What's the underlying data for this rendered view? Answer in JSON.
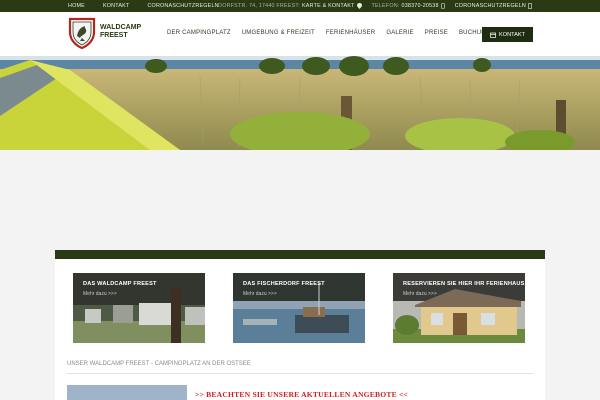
{
  "topbar": {
    "links": [
      "HOME",
      "KONTAKT",
      "CORONASCHUTZREGELN"
    ],
    "address": "DORFSTR. 74, 17440 FREEST:",
    "map_link": "KARTE & KONTAKT",
    "phone_label": "TELEFON:",
    "phone": "038370-20538",
    "corona_link": "CORONASCHUTZREGELN"
  },
  "brand": {
    "line1": "WALDCAMP",
    "line2": "FREEST"
  },
  "nav": {
    "items": [
      "DER CAMPINGPLATZ",
      "UMGEBUNG & FREIZEIT",
      "FERIENHÄUSER",
      "GALERIE",
      "PREISE",
      "BUCHUNGEN"
    ],
    "contact_button": "KONTAKT"
  },
  "cards": [
    {
      "title": "DAS WALDCAMP FREEST",
      "link": "Mehr dazu >>>"
    },
    {
      "title": "DAS FISCHERDORF FREEST",
      "link": "Mehr dazu >>>"
    },
    {
      "title": "RESERVIEREN SIE HIER  IHR FERIENHAUS",
      "link": "Mehr dazu >>>"
    }
  ],
  "section": {
    "title": "UNSER WALDCAMP FREEST - CAMPINGPLATZ AN DER OSTSEE",
    "offer": ">> BEACHTEN SIE UNSERE AKTUELLEN ANGEBOTE <<"
  },
  "colors": {
    "brand_dark": "#2a3a14",
    "offer_red": "#d11f1f"
  }
}
